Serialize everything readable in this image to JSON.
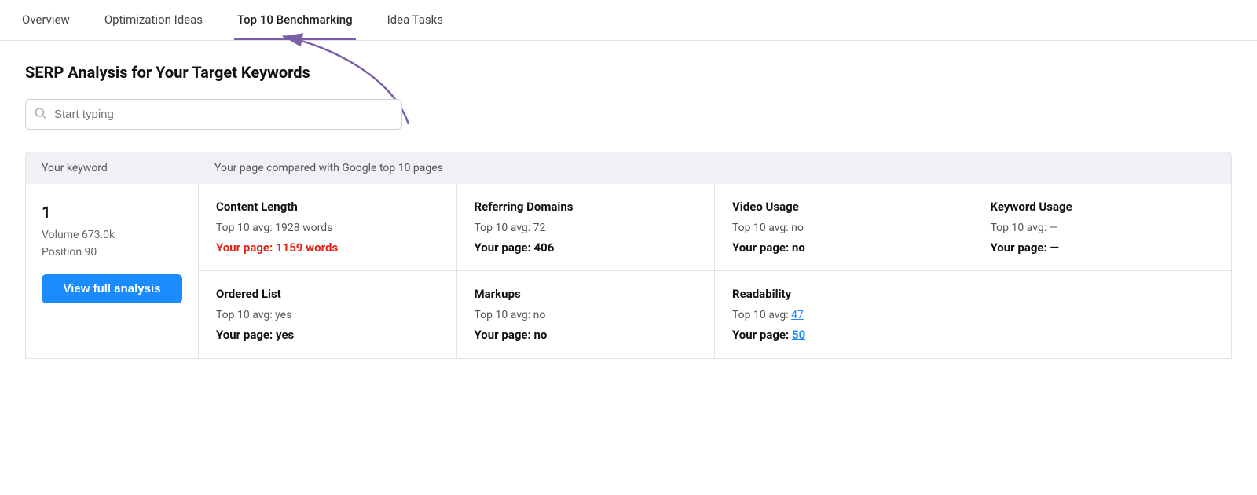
{
  "tabs": [
    {
      "id": "overview",
      "label": "Overview",
      "active": false
    },
    {
      "id": "optimization-ideas",
      "label": "Optimization Ideas",
      "active": false
    },
    {
      "id": "top-10-benchmarking",
      "label": "Top 10 Benchmarking",
      "active": true
    },
    {
      "id": "idea-tasks",
      "label": "Idea Tasks",
      "active": false
    }
  ],
  "page": {
    "title": "SERP Analysis for Your Target Keywords",
    "search_placeholder": "Start typing",
    "table_header_keyword": "Your keyword",
    "table_header_comparison": "Your page compared with Google top 10 pages"
  },
  "rows": [
    {
      "rank": "1",
      "volume": "Volume 673.0k",
      "position": "Position 90",
      "view_label": "View full analysis",
      "metrics": [
        {
          "id": "content-length",
          "title": "Content Length",
          "avg_label": "Top 10 avg: 1928 words",
          "page_label": "Your page: 1159 words",
          "page_red": true,
          "page_link": false
        },
        {
          "id": "referring-domains",
          "title": "Referring Domains",
          "avg_label": "Top 10 avg: 72",
          "page_label": "Your page: 406",
          "page_red": false,
          "page_link": false
        },
        {
          "id": "video-usage",
          "title": "Video Usage",
          "avg_label": "Top 10 avg: no",
          "page_label": "Your page: no",
          "page_red": false,
          "page_link": false
        },
        {
          "id": "keyword-usage",
          "title": "Keyword Usage",
          "avg_label": "Top 10 avg: —",
          "page_label": "Your page: —",
          "page_red": false,
          "page_link": false
        },
        {
          "id": "ordered-list",
          "title": "Ordered List",
          "avg_label": "Top 10 avg: yes",
          "page_label": "Your page: yes",
          "page_red": false,
          "page_link": false
        },
        {
          "id": "markups",
          "title": "Markups",
          "avg_label": "Top 10 avg: no",
          "page_label": "Your page: no",
          "page_red": false,
          "page_link": false
        },
        {
          "id": "readability",
          "title": "Readability",
          "avg_label": "Top 10 avg: 47",
          "page_label": "Your page: 50",
          "page_red": false,
          "avg_link": true,
          "page_link": true
        },
        {
          "id": "empty",
          "title": "",
          "avg_label": "",
          "page_label": "",
          "page_red": false,
          "page_link": false
        }
      ]
    }
  ],
  "arrow": {
    "color": "#7b5ea7"
  }
}
